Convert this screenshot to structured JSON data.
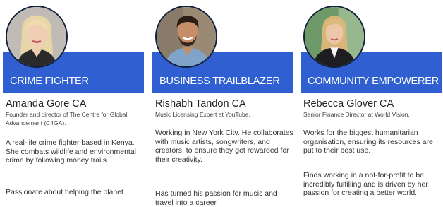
{
  "cards": [
    {
      "banner": "CRIME FIGHTER",
      "name": "Amanda Gore CA",
      "role": "Founder and director of The Centre for Global Advancement (C4GA).",
      "para1": "A real-life crime fighter based in Kenya.  She combats wildlife and environmental crime by following money trails.",
      "para2": "Passionate about helping the planet.",
      "avatar_icon": "woman-blonde-portrait"
    },
    {
      "banner": "BUSINESS TRAILBLAZER",
      "name": "Rishabh Tandon CA",
      "role": "Music Licensing Expert at YouTube.",
      "para1": "Working in New York City. He collaborates with music artists, songwriters, and creators, to ensure they get rewarded for their creativity.",
      "para2": "Has turned his passion for music and travel into a career",
      "avatar_icon": "man-smiling-portrait"
    },
    {
      "banner": "COMMUNITY EMPOWERER",
      "name": "Rebecca Glover CA",
      "role": "Senior Finance Director at World Vision.",
      "para1": "Works for the biggest humanitarian organisation, ensuring its resources are put to their best use.",
      "para2": "Finds working in a not-for-profit to be incredibly fulfilling and is driven by her passion for creating a better world.",
      "avatar_icon": "woman-office-portrait"
    }
  ],
  "colors": {
    "banner": "#2f5fd0",
    "avatar_ring": "#12213b"
  }
}
